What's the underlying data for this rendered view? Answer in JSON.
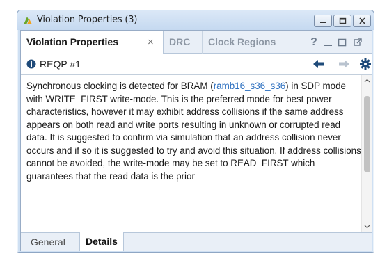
{
  "window": {
    "title": "Violation Properties (3)",
    "icons": [
      "vivado-logo-icon",
      "minimize-icon",
      "maximize-icon",
      "close-icon"
    ]
  },
  "tabs": [
    {
      "label": "Violation Properties",
      "active": true,
      "close_glyph": "×"
    },
    {
      "label": "DRC",
      "active": false
    },
    {
      "label": "Clock Regions",
      "active": false
    }
  ],
  "toolbar": {
    "help_glyph": "?",
    "icons": [
      "help-icon",
      "minimize-panel-icon",
      "restore-panel-icon",
      "float-panel-icon"
    ]
  },
  "header": {
    "title": "REQP #1",
    "icons": [
      "info-icon",
      "back-arrow-icon",
      "forward-arrow-icon",
      "settings-gear-icon"
    ]
  },
  "details": {
    "text_before_link": "Synchronous clocking is detected for BRAM (",
    "link_text": "ramb16_s36_s36",
    "text_after_link": ") in SDP mode with WRITE_FIRST write-mode. This is the preferred mode for best power characteristics, however it may exhibit address collisions if the same address appears on both read and write ports resulting in unknown or corrupted read data. It is suggested to confirm via simulation that an address collision never occurs and if so it is suggested to try and avoid this situation. If address collisions cannot be avoided, the write-mode may be set to READ_FIRST which guarantees that the read data is the prior"
  },
  "bottom_tabs": [
    {
      "label": "General",
      "active": false
    },
    {
      "label": "Details",
      "active": true
    }
  ],
  "colors": {
    "accent_blue": "#2a6ebf",
    "title_bar": "#cfe0f3",
    "icon_dark": "#1f4b7a"
  }
}
